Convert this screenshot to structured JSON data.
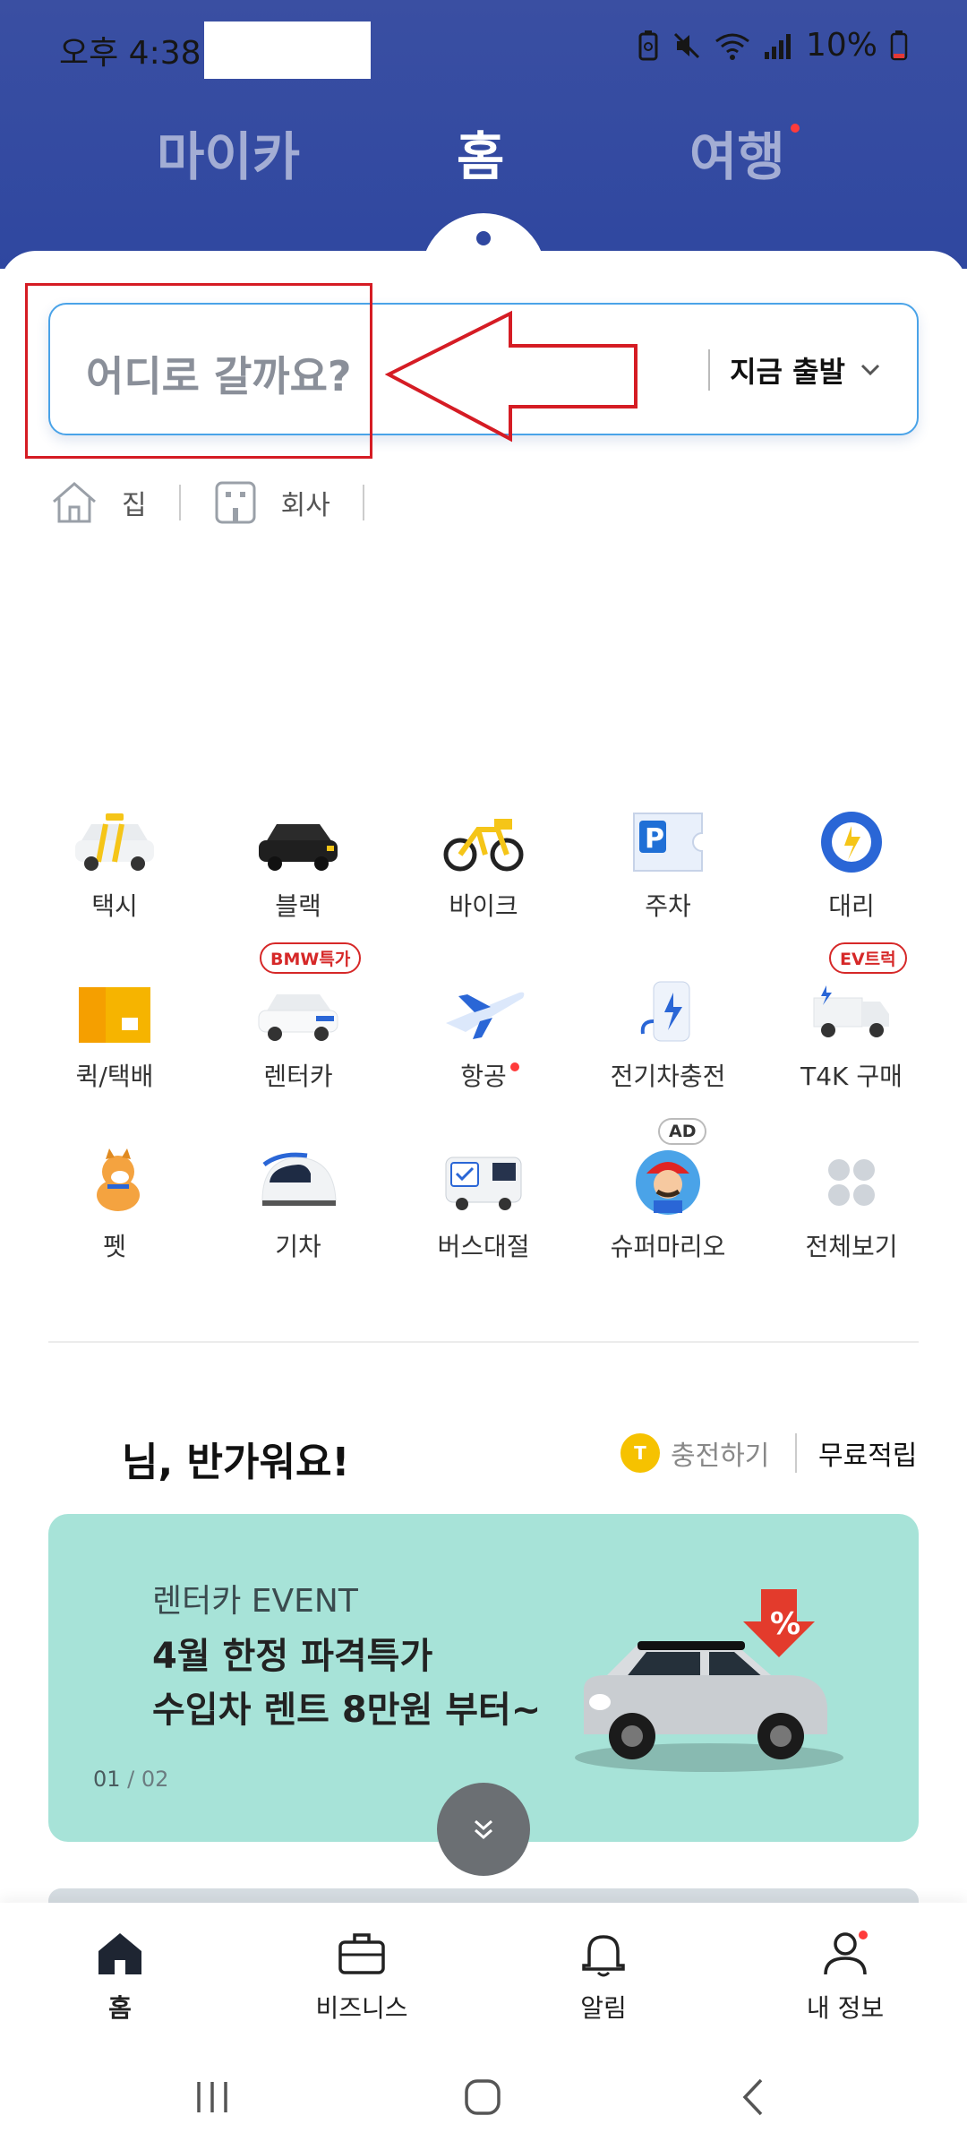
{
  "status_bar": {
    "time": "오후 4:38",
    "battery": "10%"
  },
  "top_tabs": {
    "mycar": "마이카",
    "home": "홈",
    "travel": "여행"
  },
  "search": {
    "placeholder": "어디로 갈까요?",
    "depart": "지금 출발"
  },
  "shortcuts": {
    "home": "집",
    "work": "회사"
  },
  "services": [
    {
      "label": "택시",
      "icon": "taxi-icon"
    },
    {
      "label": "블랙",
      "icon": "black-car-icon"
    },
    {
      "label": "바이크",
      "icon": "bike-icon"
    },
    {
      "label": "주차",
      "icon": "parking-icon"
    },
    {
      "label": "대리",
      "icon": "steering-wheel-icon"
    },
    {
      "label": "퀵/택배",
      "icon": "box-icon"
    },
    {
      "label": "렌터카",
      "icon": "rental-car-icon",
      "badge": "BMW특가"
    },
    {
      "label": "항공",
      "icon": "airplane-icon"
    },
    {
      "label": "전기차충전",
      "icon": "ev-charger-icon"
    },
    {
      "label": "T4K 구매",
      "icon": "truck-icon",
      "badge": "EV트럭"
    },
    {
      "label": "펫",
      "icon": "dog-icon"
    },
    {
      "label": "기차",
      "icon": "train-icon"
    },
    {
      "label": "버스대절",
      "icon": "bus-icon"
    },
    {
      "label": "슈퍼마리오",
      "icon": "mario-icon",
      "badge": "AD"
    },
    {
      "label": "전체보기",
      "icon": "grid-icon"
    }
  ],
  "greeting": {
    "text": "님, 반가워요!",
    "coin_letter": "T",
    "charge": "충전하기",
    "free": "무료적립"
  },
  "banner": {
    "eyebrow": "렌터카 EVENT",
    "line1": "4월 한정 파격특가",
    "line2": "수입차 렌트 8만원 부터~",
    "counter_current": "01",
    "counter_total": " / 02",
    "badge": "%"
  },
  "bottom_nav": {
    "home": "홈",
    "business": "비즈니스",
    "alerts": "알림",
    "profile": "내 정보"
  },
  "colors": {
    "header": "#2f47a0",
    "search_border": "#4aa3e8",
    "annotation": "#d51c24",
    "banner_bg": "#a7e3d8"
  }
}
